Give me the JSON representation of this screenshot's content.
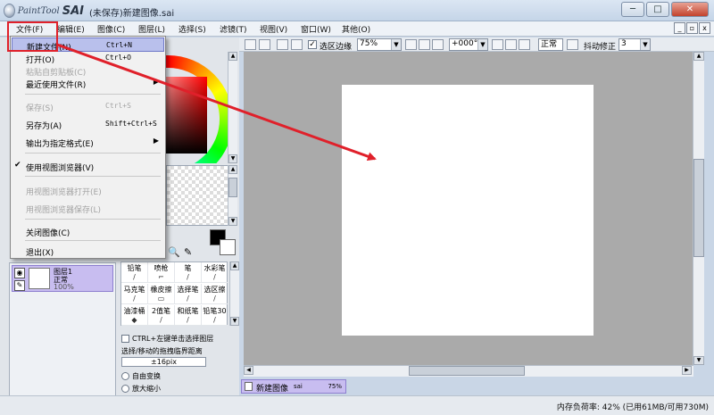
{
  "window": {
    "logo_small": "PaintTool",
    "logo_big": "SAI",
    "title": "(未保存)新建图像.sai"
  },
  "menubar": [
    "文件(F)",
    "编辑(E)",
    "图像(C)",
    "图层(L)",
    "选择(S)",
    "滤镜(T)",
    "视图(V)",
    "窗口(W)",
    "其他(O)"
  ],
  "toolbar": {
    "selection_edge_label": "选区边缘",
    "zoom": "75%",
    "rotation": "+000°",
    "mode": "正常",
    "stabilizer_label": "抖动修正",
    "stabilizer_value": "3"
  },
  "file_menu": {
    "new_file": {
      "label": "新建文件(N)",
      "shortcut": "Ctrl+N"
    },
    "open": {
      "label": "打开(O)",
      "shortcut": "Ctrl+O"
    },
    "paste_from_clipboard": {
      "label": "粘贴自剪贴板(C)"
    },
    "recent": {
      "label": "最近使用文件(R)"
    },
    "save": {
      "label": "保存(S)",
      "shortcut": "Ctrl+S"
    },
    "save_as": {
      "label": "另存为(A)",
      "shortcut": "Shift+Ctrl+S"
    },
    "export": {
      "label": "输出为指定格式(E)"
    },
    "use_viewer": {
      "label": "使用视图浏览器(V)"
    },
    "viewer_open": {
      "label": "用视图浏览器打开(E)"
    },
    "viewer_save": {
      "label": "用视图浏览器保存(L)"
    },
    "close_image": {
      "label": "关闭图像(C)"
    },
    "exit": {
      "label": "退出(X)"
    }
  },
  "layers": {
    "name": "图层1",
    "mode": "正常",
    "opacity": "100%"
  },
  "brushes": [
    {
      "name": "铅笔",
      "icon": "/"
    },
    {
      "name": "喷枪",
      "icon": "⌐"
    },
    {
      "name": "笔",
      "icon": "/"
    },
    {
      "name": "水彩笔",
      "icon": "/"
    },
    {
      "name": "马克笔",
      "icon": "/"
    },
    {
      "name": "橡皮擦",
      "icon": "▭"
    },
    {
      "name": "选择笔",
      "icon": "/"
    },
    {
      "name": "选区擦",
      "icon": "/"
    },
    {
      "name": "油漆桶",
      "icon": "◆"
    },
    {
      "name": "2值笔",
      "icon": "/"
    },
    {
      "name": "和纸笔",
      "icon": "/"
    },
    {
      "name": "铅笔30",
      "icon": "/"
    }
  ],
  "options": {
    "ctrl_click_label": "CTRL+左键单击选择图层",
    "drag_distance_label": "选择/移动的拖拽临界距离",
    "drag_distance_value": "±16pix",
    "free_transform": "自由变换",
    "scale": "放大缩小"
  },
  "doc_tab": {
    "name": "新建图像",
    "ext": "sai",
    "zoom": "75%"
  },
  "status": {
    "memory": "内存负荷率: 42% (已用61MB/可用730M)"
  },
  "colors": {
    "highlight": "#b9c0ec",
    "callout": "#e0202a",
    "layer_selected": "#c8bdf0",
    "canvas_bg": "#aaaaaa"
  }
}
